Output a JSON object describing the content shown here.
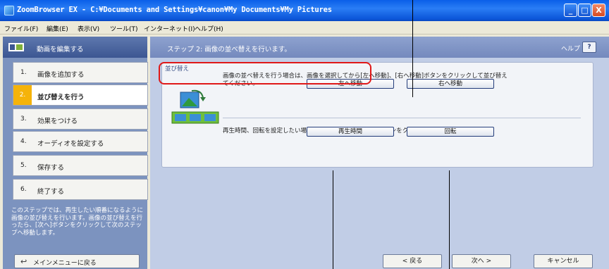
{
  "titlebar": {
    "title": "ZoomBrowser EX - C:¥Documents and Settings¥canon¥My Documents¥My Pictures",
    "minimize_label": "_",
    "maximize_label": "□",
    "close_label": "X"
  },
  "menubar": {
    "items": [
      "ファイル(F)",
      "編集(E)",
      "表示(V)",
      "ツール(T)",
      "インターネット(I)",
      "ヘルプ(H)"
    ]
  },
  "left_pane": {
    "title": "動画を編集する",
    "steps": [
      {
        "num": "1.",
        "label": "画像を追加する"
      },
      {
        "num": "2.",
        "label": "並び替えを行う"
      },
      {
        "num": "3.",
        "label": "効果をつける"
      },
      {
        "num": "4.",
        "label": "オーディオを設定する"
      },
      {
        "num": "5.",
        "label": "保存する"
      },
      {
        "num": "6.",
        "label": "終了する"
      }
    ],
    "active_step": 2,
    "info_text": "このステップでは、再生したい順番になるように画像の並び替えを行います。画像の並び替えを行ったら、[次へ]ボタンをクリックして次のステップへ移動します。",
    "back_button_label": "メインメニューに戻る"
  },
  "right_pane": {
    "step_title": "ステップ 2: 画像の並べ替えを行います。",
    "help_label": "ヘルプ",
    "help_icon_label": "?",
    "sort_section": {
      "legend": "並び替え",
      "description": "画像の並べ替えを行う場合は、画像を選択してから[左へ移動]、[右へ移動]ボタンをクリックして並び替えてください。",
      "move_left_label": "左へ移動",
      "move_right_label": "右へ移動",
      "secondary_description": "再生時間、回転を設定したい場合は、画像を選択してからボタンをクリックしてください。",
      "playtime_label": "再生時間",
      "rotate_label": "回転"
    },
    "nav": {
      "prev_label": "< 戻る",
      "next_label": "次へ >",
      "cancel_label": "キャンセル"
    }
  },
  "colors": {
    "titlebar": "#0a5fe8",
    "left_pane": "#7c93bf",
    "right_pane": "#c1cde6",
    "active_step_accent": "#f5b30a",
    "highlight": "#e01818"
  },
  "icons": {
    "app": "zoombrowser-icon",
    "step_header": "film-icon",
    "sort": "thumbnail-reorder-icon",
    "back": "return-arrow-icon"
  }
}
